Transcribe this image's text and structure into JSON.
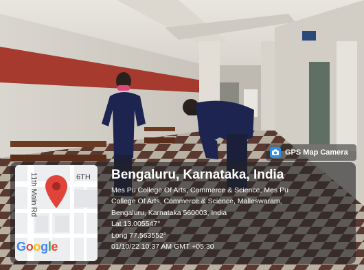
{
  "photo": {
    "description_icon": "photo-scene"
  },
  "camera_badge": {
    "label": "GPS Map Camera",
    "icon": "map-camera-icon",
    "icon_color": "#2f8de4"
  },
  "map": {
    "road_vertical": "11th Main Rd",
    "road_horizontal": "6TH",
    "logo": "Google",
    "pin_color": "#e0433a"
  },
  "location": {
    "title": "Bengaluru, Karnataka, India",
    "address_lines": [
      "Mes Pu College Of Arts, Commerce & Science, Mes Pu",
      "College Of Arts, Commerce & Science, Malleswaram,",
      "Bengaluru, Karnataka 560003, India"
    ],
    "lat": "Lat 13.005547°",
    "long": "Long 77.563552°",
    "timestamp": "01/10/22 10:37 AM GMT +05:30"
  }
}
